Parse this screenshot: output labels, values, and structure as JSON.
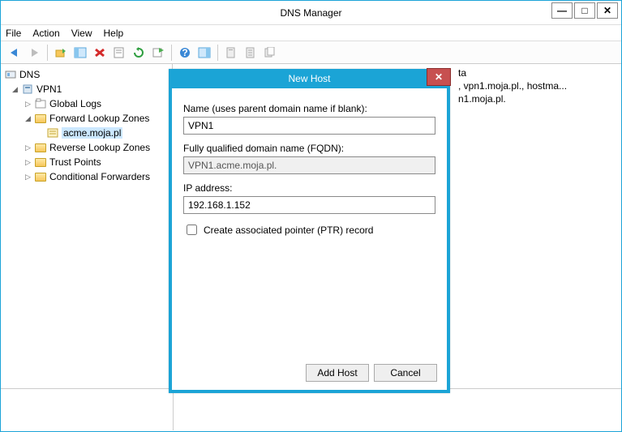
{
  "window": {
    "title": "DNS Manager"
  },
  "win_buttons": {
    "min": "—",
    "max": "□",
    "close": "✕"
  },
  "menu": {
    "file": "File",
    "action": "Action",
    "view": "View",
    "help": "Help"
  },
  "tree": {
    "root": "DNS",
    "server": "VPN1",
    "global_logs": "Global Logs",
    "fwd": "Forward Lookup Zones",
    "zone": "acme.moja.pl",
    "rev": "Reverse Lookup Zones",
    "trust": "Trust Points",
    "cond": "Conditional Forwarders"
  },
  "list": {
    "row1_tail": "ta",
    "row2_tail": ", vpn1.moja.pl., hostma...",
    "row3_tail": "n1.moja.pl."
  },
  "dialog": {
    "title": "New Host",
    "name_label": "Name (uses parent domain name if blank):",
    "name_value": "VPN1",
    "fqdn_label": "Fully qualified domain name (FQDN):",
    "fqdn_value": "VPN1.acme.moja.pl.",
    "ip_label": "IP address:",
    "ip_value": "192.168.1.152",
    "ptr_label": "Create associated pointer (PTR) record",
    "add": "Add Host",
    "cancel": "Cancel",
    "close_x": "✕"
  }
}
